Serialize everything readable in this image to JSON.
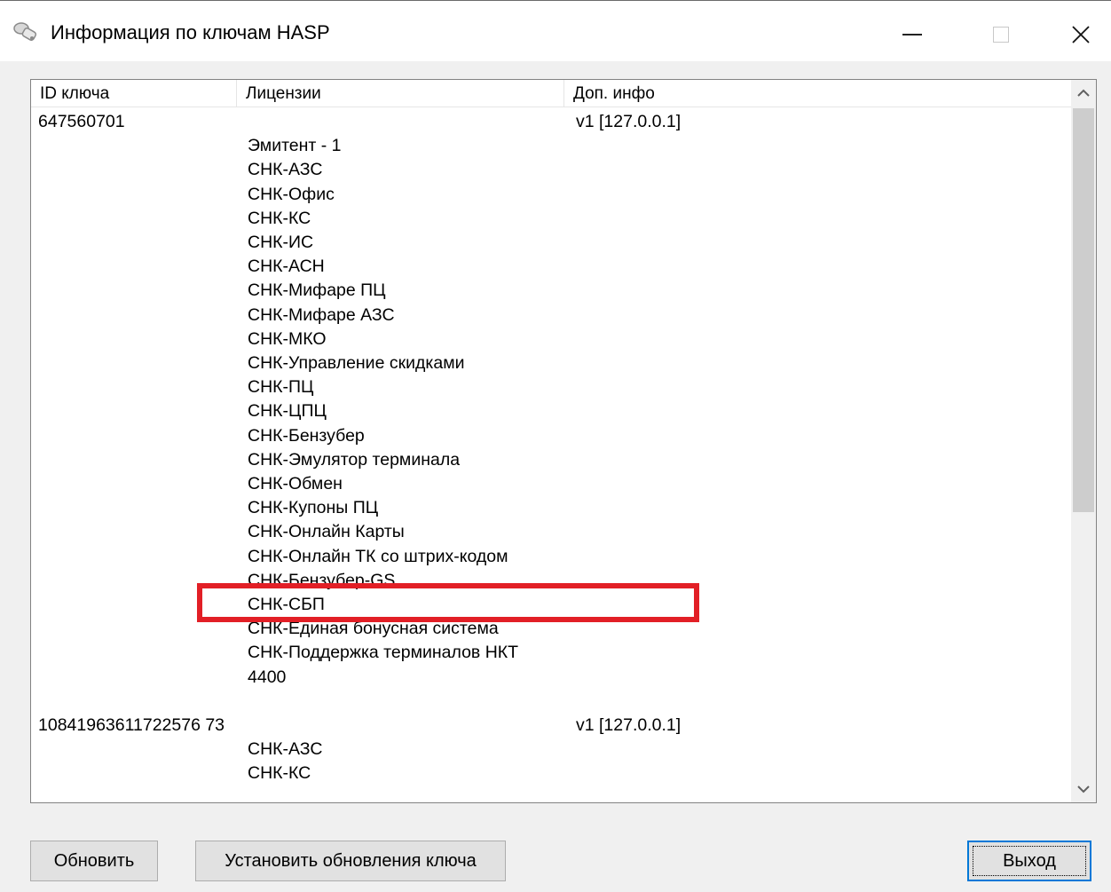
{
  "window": {
    "title": "Информация по ключам HASP",
    "icon": "hasp-key-icon",
    "controls": {
      "minimize": "minimize-icon",
      "maximize": "maximize-icon",
      "close": "✕"
    }
  },
  "list": {
    "columns": [
      "ID ключа",
      "Лицензии",
      "Доп. инфо"
    ],
    "entries": [
      {
        "key_id": "647560701",
        "info": "v1 [127.0.0.1]",
        "licenses": [
          "Эмитент - 1",
          "СНК-АЗС",
          "СНК-Офис",
          "СНК-КС",
          "СНК-ИС",
          "СНК-АСН",
          "СНК-Мифаре ПЦ",
          "СНК-Мифаре АЗС",
          "СНК-МКО",
          "СНК-Управление скидками",
          "СНК-ПЦ",
          "СНК-ЦПЦ",
          "СНК-Бензубер",
          "СНК-Эмулятор терминала",
          "СНК-Обмен",
          "СНК-Купоны ПЦ",
          "СНК-Онлайн Карты",
          "СНК-Онлайн ТК со штрих-кодом",
          "СНК-Бензубер-GS",
          "СНК-СБП",
          "СНК-Единая бонусная система",
          "СНК-Поддержка терминалов НКТ",
          "4400"
        ]
      },
      {
        "key_id": "10841963611722576 73",
        "info": "v1 [127.0.0.1]",
        "licenses": [
          "СНК-АЗС",
          "СНК-КС"
        ]
      }
    ],
    "highlighted_license": "СНК-СБП"
  },
  "buttons": {
    "refresh": "Обновить",
    "update_key": "Установить обновления ключа",
    "exit": "Выход"
  },
  "colors": {
    "highlight": "#e21f26",
    "focus_border": "#0078d7"
  }
}
